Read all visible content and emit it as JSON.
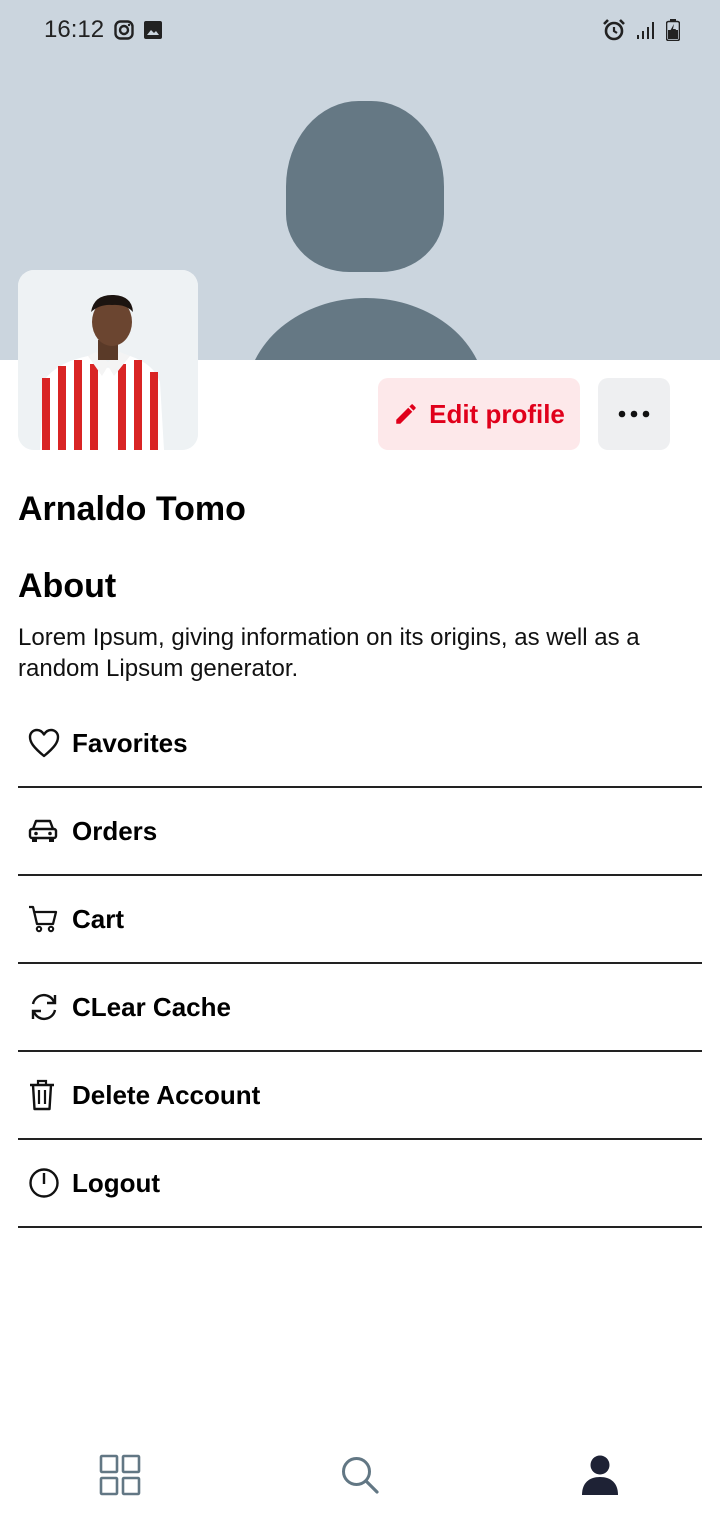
{
  "status_bar": {
    "time": "16:12",
    "left_icons": [
      "instagram-icon",
      "image-icon"
    ],
    "right_icons": [
      "alarm-icon",
      "signal-icon",
      "battery-charging-icon"
    ]
  },
  "cover": {
    "icon": "person-placeholder-icon",
    "background": "#cbd5de",
    "figure_color": "#657884"
  },
  "profile": {
    "avatar": "profile-photo",
    "name": "Arnaldo Tomo",
    "edit_button_label": "Edit profile",
    "more_button_icon": "more-horizontal-icon"
  },
  "about": {
    "title": "About",
    "text": "Lorem Ipsum, giving information on its origins, as well as a random Lipsum generator."
  },
  "menu": {
    "items": [
      {
        "label": "Favorites",
        "icon": "heart-icon"
      },
      {
        "label": "Orders",
        "icon": "car-icon"
      },
      {
        "label": "Cart",
        "icon": "cart-icon"
      },
      {
        "label": "CLear Cache",
        "icon": "refresh-icon"
      },
      {
        "label": "Delete Account",
        "icon": "trash-icon"
      },
      {
        "label": "Logout",
        "icon": "power-icon"
      }
    ]
  },
  "bottom_nav": {
    "items": [
      {
        "icon": "grid-icon",
        "active": false
      },
      {
        "icon": "search-icon",
        "active": false
      },
      {
        "icon": "user-icon",
        "active": true
      }
    ]
  },
  "colors": {
    "accent": "#e0001b",
    "accent_bg": "#fde8ea",
    "nav_inactive": "#627784",
    "nav_active": "#1e2235"
  }
}
